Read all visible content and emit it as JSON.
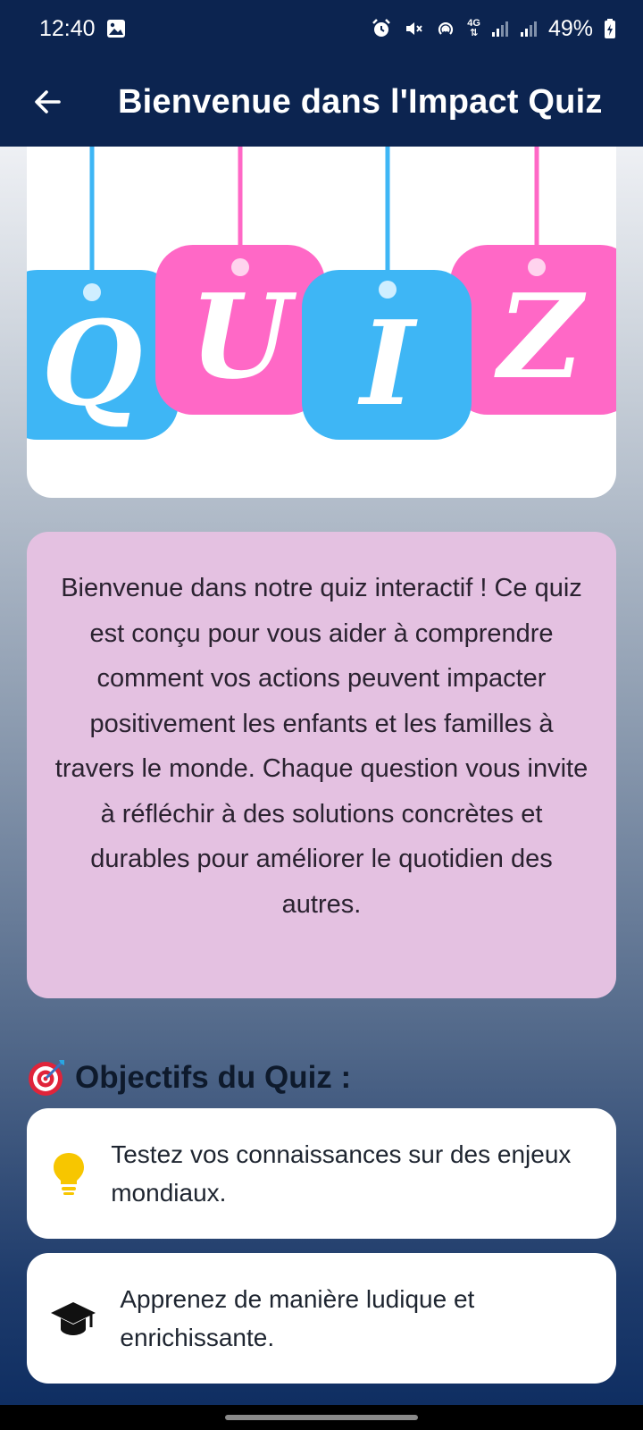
{
  "status_bar": {
    "time": "12:40",
    "battery": "49%",
    "network": "4G"
  },
  "app_bar": {
    "title": "Bienvenue dans l'Impact Quiz"
  },
  "hero": {
    "letters": [
      "Q",
      "U",
      "I",
      "Z"
    ],
    "colors": {
      "blue": "#3eb6f5",
      "pink": "#ff68c6"
    }
  },
  "intro": {
    "text": "Bienvenue dans notre quiz interactif ! Ce quiz est conçu pour vous aider à comprendre comment vos actions peuvent impacter positivement les enfants et les familles à travers le monde. Chaque question vous invite à réfléchir à des solutions concrètes et durables pour améliorer le quotidien des autres."
  },
  "objectives": {
    "emoji": "🎯",
    "title": "Objectifs du Quiz :",
    "items": [
      {
        "icon": "lightbulb-icon",
        "text": "Testez vos connaissances sur des enjeux mondiaux."
      },
      {
        "icon": "graduation-cap-icon",
        "text": "Apprenez de manière ludique et enrichissante."
      }
    ]
  },
  "colors": {
    "app_bar": "#0c2450",
    "intro_card": "#e4c1e1",
    "bulb": "#f7c600"
  }
}
